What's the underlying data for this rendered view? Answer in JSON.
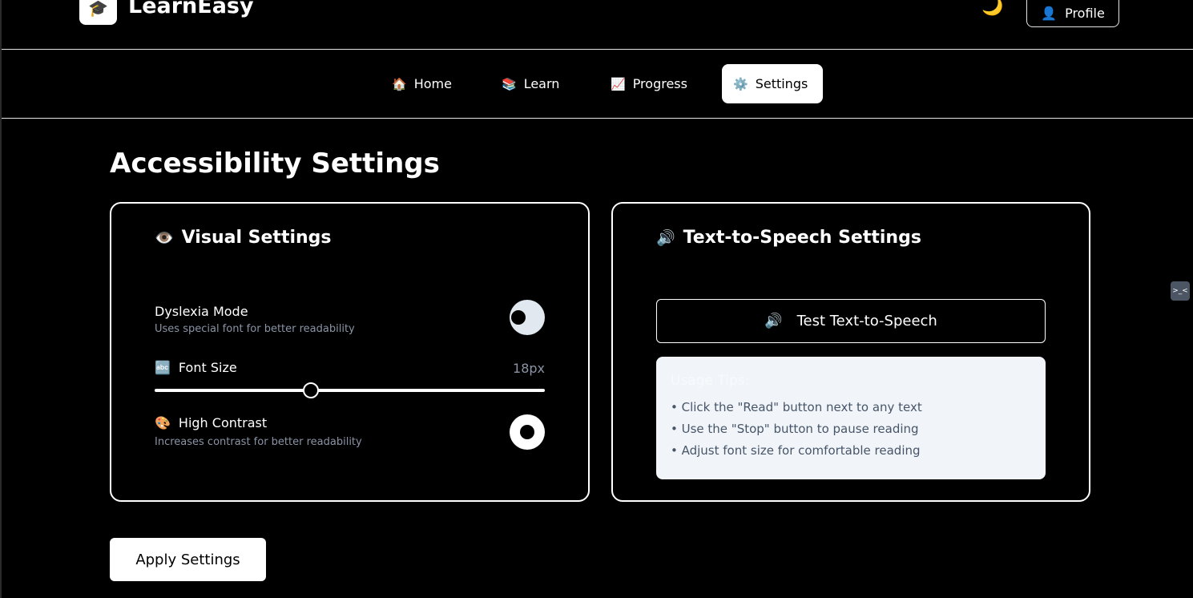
{
  "header": {
    "logo_icon": "🎓",
    "brand": "LearnEasy",
    "theme_icon": "🌙",
    "profile_icon": "👤",
    "profile_label": "Profile"
  },
  "nav": {
    "items": [
      {
        "icon": "🏠",
        "label": "Home"
      },
      {
        "icon": "📚",
        "label": "Learn"
      },
      {
        "icon": "📈",
        "label": "Progress"
      },
      {
        "icon": "⚙️",
        "label": "Settings"
      }
    ],
    "active": "Settings"
  },
  "main": {
    "title": "Accessibility Settings",
    "visual": {
      "icon": "👁️",
      "title": "Visual Settings",
      "dyslexia_label": "Dyslexia Mode",
      "dyslexia_desc": "Uses special font for better readability",
      "dyslexia_enabled": false,
      "font_icon": "🔤",
      "font_label": "Font Size",
      "font_value": "18px",
      "font_slider_fraction": 0.4,
      "contrast_icon": "🎨",
      "contrast_label": "High Contrast",
      "contrast_desc": "Increases contrast for better readability",
      "contrast_enabled": true
    },
    "tts": {
      "icon": "🔊",
      "title": "Text-to-Speech Settings",
      "test_icon": "🔊",
      "test_label": "Test Text-to-Speech",
      "tips_title": "Usage Tips:",
      "tips": [
        "• Click the \"Read\" button next to any text",
        "• Use the \"Stop\" button to pause reading",
        "• Adjust font size for comfortable reading"
      ]
    },
    "apply_label": "Apply Settings"
  },
  "side_widget": {
    "label": ">_<"
  }
}
